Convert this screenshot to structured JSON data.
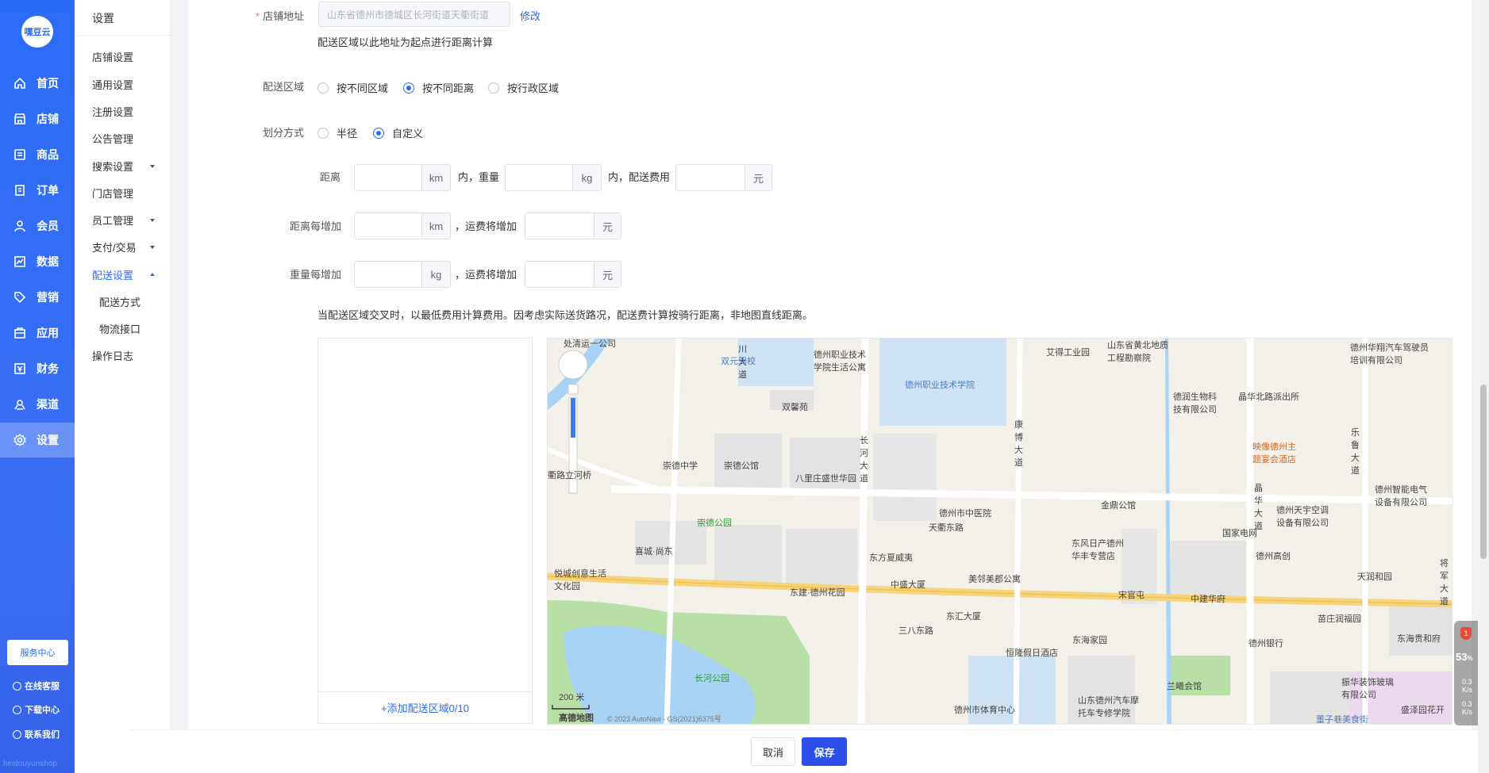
{
  "sidebar": {
    "logo": "嘿豆云",
    "items": [
      {
        "label": "首页",
        "icon": "home-icon"
      },
      {
        "label": "店铺",
        "icon": "store-icon"
      },
      {
        "label": "商品",
        "icon": "goods-icon"
      },
      {
        "label": "订单",
        "icon": "order-icon"
      },
      {
        "label": "会员",
        "icon": "member-icon"
      },
      {
        "label": "数据",
        "icon": "chart-icon"
      },
      {
        "label": "营销",
        "icon": "tag-icon"
      },
      {
        "label": "应用",
        "icon": "app-icon"
      },
      {
        "label": "财务",
        "icon": "finance-icon"
      },
      {
        "label": "渠道",
        "icon": "channel-icon"
      },
      {
        "label": "设置",
        "icon": "gear-icon"
      }
    ],
    "active_index": 10,
    "service_center": "服务中心",
    "online_service": "在线客服",
    "download_center": "下载中心",
    "contact_us": "联系我们",
    "watermark": "heidouyunshop"
  },
  "subnav": {
    "title": "设置",
    "items": [
      {
        "label": "店铺设置"
      },
      {
        "label": "通用设置"
      },
      {
        "label": "注册设置"
      },
      {
        "label": "公告管理"
      },
      {
        "label": "搜索设置",
        "caret": "down"
      },
      {
        "label": "门店管理"
      },
      {
        "label": "员工管理",
        "caret": "down"
      },
      {
        "label": "支付/交易",
        "caret": "down"
      },
      {
        "label": "配送设置",
        "caret": "up",
        "active": true
      }
    ],
    "children": [
      "配送方式",
      "物流接口"
    ],
    "last": "操作日志"
  },
  "form": {
    "address_label": "店铺地址",
    "address_value": "山东省德州市德城区长河街道天衢街道",
    "modify_link": "修改",
    "address_hint": "配送区域以此地址为起点进行距离计算",
    "zone_label": "配送区域",
    "zone_options": [
      "按不同区域",
      "按不同距离",
      "按行政区域"
    ],
    "zone_selected": 1,
    "split_label": "划分方式",
    "split_options": [
      "半径",
      "自定义"
    ],
    "split_selected": 1,
    "distance_label": "距离",
    "km": "km",
    "within_weight": "内，重量",
    "kg": "kg",
    "within_fee": "内，配送费用",
    "yuan": "元",
    "distance_increase_label": "距离每增加",
    "fee_increase": "，运费将增加",
    "weight_increase_label": "重量每增加",
    "note": "当配送区域交叉时，以最低费用计算费用。因考虑实际送货路况，配送费计算按骑行距离，非地图直线距离。",
    "add_zone": "+添加配送区域0/10"
  },
  "map": {
    "scale": "200 米",
    "brand": "高德地图",
    "copyright": "© 2023 AutoNavi - GS(2021)6375号",
    "labels": [
      {
        "text": "双元驾校",
        "style": "blue"
      },
      {
        "text": "德州职业技术学院生活公寓",
        "style": ""
      },
      {
        "text": "德州职业技术学院",
        "style": "blue"
      },
      {
        "text": "艾得工业园",
        "style": ""
      },
      {
        "text": "山东省黄北地质工程勘察院",
        "style": ""
      },
      {
        "text": "德州华翔汽车驾驶员培训有限公司",
        "style": ""
      },
      {
        "text": "德润生物科技有限公司",
        "style": ""
      },
      {
        "text": "晶华北路派出所",
        "style": ""
      },
      {
        "text": "映像德州主题宴会酒店",
        "style": "orange"
      },
      {
        "text": "双馨苑",
        "style": ""
      },
      {
        "text": "崇德中学",
        "style": ""
      },
      {
        "text": "崇德公馆",
        "style": ""
      },
      {
        "text": "八里庄盛世华园",
        "style": ""
      },
      {
        "text": "长河大道",
        "style": ""
      },
      {
        "text": "康博大道",
        "style": ""
      },
      {
        "text": "德州市中医院",
        "style": ""
      },
      {
        "text": "金鼎公馆",
        "style": ""
      },
      {
        "text": "晶华大道",
        "style": ""
      },
      {
        "text": "德州天宇空调设备有限公司",
        "style": ""
      },
      {
        "text": "德州智能电气设备有限公司",
        "style": ""
      },
      {
        "text": "乐鲁大道",
        "style": ""
      },
      {
        "text": "天衢东路",
        "style": ""
      },
      {
        "text": "崇德公园",
        "style": "green"
      },
      {
        "text": "国家电网",
        "style": ""
      },
      {
        "text": "德州高创",
        "style": ""
      },
      {
        "text": "悦城创意生活文化园",
        "style": ""
      },
      {
        "text": "喜城·尚东",
        "style": ""
      },
      {
        "text": "东方夏威夷",
        "style": ""
      },
      {
        "text": "东风日产德州华丰专营店",
        "style": ""
      },
      {
        "text": "美邻美郡公寓",
        "style": ""
      },
      {
        "text": "宋官屯",
        "style": ""
      },
      {
        "text": "中建华府",
        "style": ""
      },
      {
        "text": "天润和园",
        "style": ""
      },
      {
        "text": "东建·德州花园",
        "style": ""
      },
      {
        "text": "中盛大厦",
        "style": ""
      },
      {
        "text": "苗庄润福园",
        "style": ""
      },
      {
        "text": "三八东路",
        "style": ""
      },
      {
        "text": "东汇大厦",
        "style": ""
      },
      {
        "text": "东海家园",
        "style": ""
      },
      {
        "text": "德州银行",
        "style": ""
      },
      {
        "text": "东海贵和府",
        "style": ""
      },
      {
        "text": "长河公园",
        "style": "green"
      },
      {
        "text": "恒隆假日酒店",
        "style": ""
      },
      {
        "text": "山东德州汽车摩托车专修学院",
        "style": ""
      },
      {
        "text": "德州市体育中心",
        "style": ""
      },
      {
        "text": "兰曦会馆",
        "style": ""
      },
      {
        "text": "振华装饰玻璃有限公司",
        "style": ""
      },
      {
        "text": "盛泽园花开",
        "style": ""
      },
      {
        "text": "董子巷美食街",
        "style": "blue"
      },
      {
        "text": "衢路立河桥",
        "style": ""
      },
      {
        "text": "将军大道",
        "style": ""
      },
      {
        "text": "处清运一公司",
        "style": ""
      },
      {
        "text": "川大道",
        "style": ""
      }
    ]
  },
  "actions": {
    "cancel": "取消",
    "save": "保存"
  },
  "widget": {
    "badge": "1",
    "percent": "53",
    "percent_sign": "%",
    "up_value": "0.3",
    "up_unit": "K/s",
    "down_value": "0.3",
    "down_unit": "K/s"
  }
}
